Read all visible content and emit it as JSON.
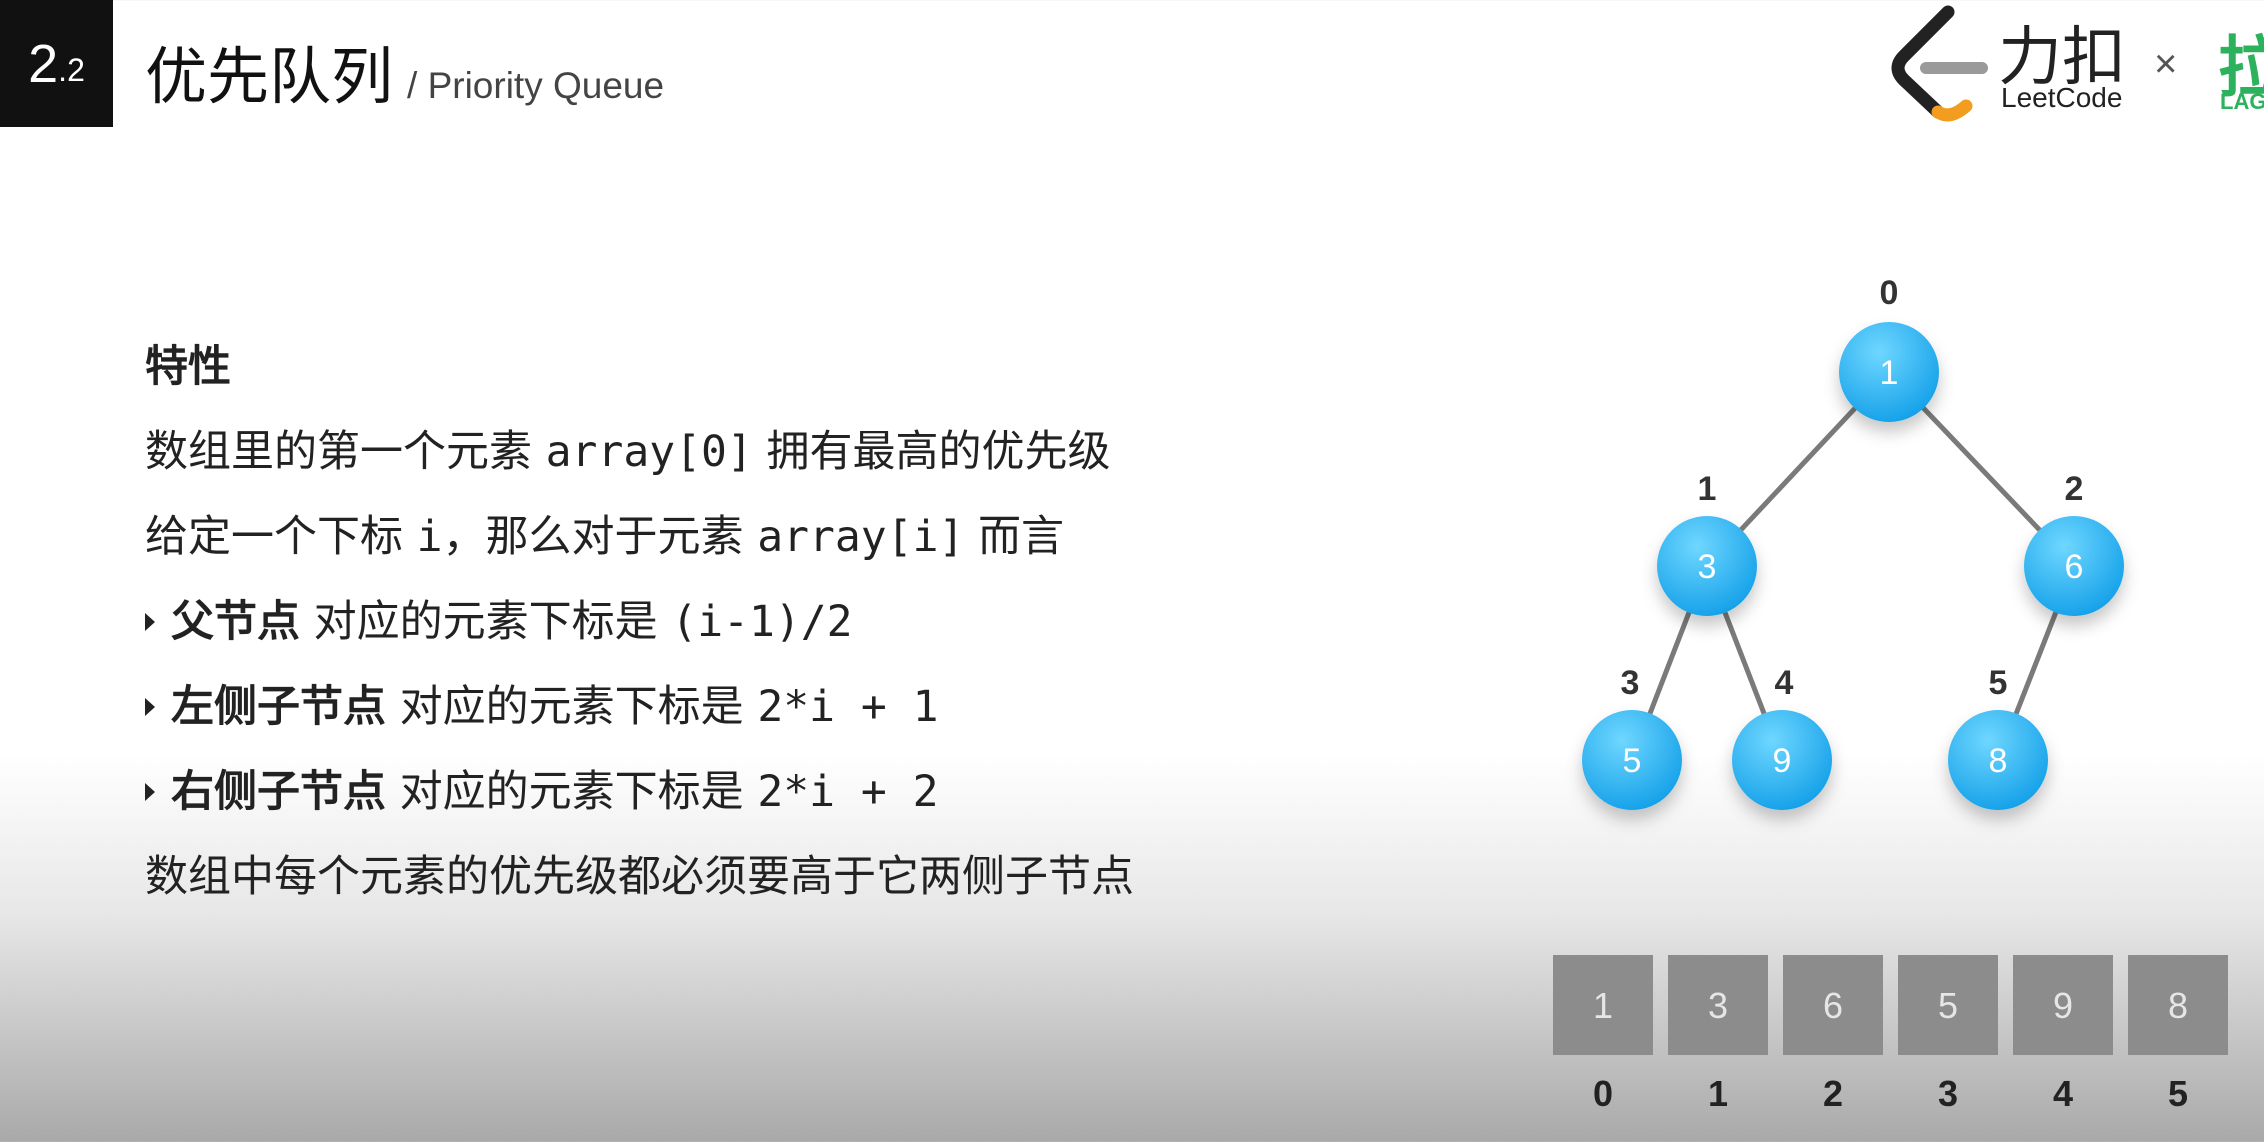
{
  "header": {
    "section_main": "2",
    "section_sub": ".2",
    "title_cn": "优先队列",
    "title_en": "/ Priority Queue"
  },
  "logo": {
    "brand_cn": "力扣",
    "brand_en": "LeetCode",
    "times": "×",
    "partner_cn": "拉",
    "partner_en": "LAG",
    "colors": {
      "dark": "#222222",
      "orange": "#f29d1f",
      "green": "#2cb15c"
    }
  },
  "content": {
    "heading": "特性",
    "line1_a": "数组里的第一个元素 ",
    "line1_code": "array[0]",
    "line1_b": " 拥有最高的优先级",
    "line2_a": "给定一个下标 ",
    "line2_code1": "i",
    "line2_b": "，那么对于元素 ",
    "line2_code2": "array[i]",
    "line2_c": " 而言",
    "bullets": [
      {
        "bold": "父节点",
        "text": " 对应的元素下标是 ",
        "code": "(i-1)/2"
      },
      {
        "bold": "左侧子节点",
        "text": " 对应的元素下标是 ",
        "code": "2*i + 1"
      },
      {
        "bold": "右侧子节点",
        "text": " 对应的元素下标是 ",
        "code": "2*i + 2"
      }
    ],
    "line_last": "数组中每个元素的优先级都必须要高于它两侧子节点"
  },
  "heap": {
    "nodes": [
      {
        "index": "0",
        "value": "1"
      },
      {
        "index": "1",
        "value": "3"
      },
      {
        "index": "2",
        "value": "6"
      },
      {
        "index": "3",
        "value": "5"
      },
      {
        "index": "4",
        "value": "9"
      },
      {
        "index": "5",
        "value": "8"
      }
    ],
    "edges": [
      [
        0,
        1
      ],
      [
        0,
        2
      ],
      [
        1,
        3
      ],
      [
        1,
        4
      ],
      [
        2,
        5
      ]
    ],
    "array_values": [
      "1",
      "3",
      "6",
      "5",
      "9",
      "8"
    ],
    "array_indices": [
      "0",
      "1",
      "2",
      "3",
      "4",
      "5"
    ],
    "colors": {
      "node_light": "#6fd7ff",
      "node_dark": "#129fe8",
      "edge": "#7a7a7a",
      "cell": "#8c8c8c"
    }
  }
}
